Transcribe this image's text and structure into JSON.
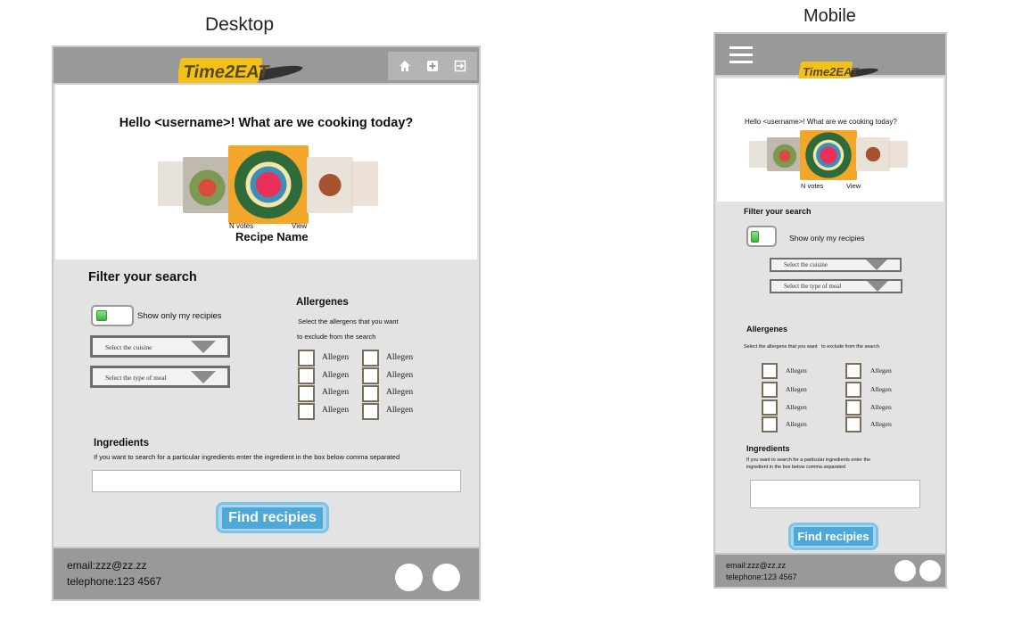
{
  "captions": {
    "desktop": "Desktop",
    "mobile": "Mobile"
  },
  "logo_text": "Time2EAT",
  "greeting": "Hello <username>! What are we cooking today?",
  "carousel": {
    "votes": "N votes",
    "view": "View",
    "recipe_name": "Recipe Name"
  },
  "filter": {
    "title": "Filter your search",
    "toggle_label": "Show only my recipies",
    "cuisine_placeholder": "Select the cuisine",
    "meal_placeholder": "Select the type of meal"
  },
  "allergenes": {
    "title": "Allergenes",
    "desc_desktop_1": "Select the allergens that you want",
    "desc_desktop_2": "to exclude from the search",
    "desc_mobile": "Select the allergens that you want   to exclude from the search",
    "items": [
      "Allegen",
      "Allegen",
      "Allegen",
      "Allegen",
      "Allegen",
      "Allegen",
      "Allegen",
      "Allegen"
    ]
  },
  "ingredients": {
    "title": "Ingredients",
    "desc": "If you want to search for a particular ingredients enter the ingredient in the box below comma separated",
    "desc_mobile_1": "If you want to search for a particular ingredients enter the",
    "desc_mobile_2": "ingredient in the box below comma separated",
    "value": ""
  },
  "find_button": "Find recipies",
  "footer": {
    "email": "email:zzz@zz.zz",
    "telephone": "telephone:123 4567"
  },
  "icons": {
    "home": "home-icon",
    "add": "plus-square-icon",
    "logout": "sign-out-icon",
    "menu": "hamburger-icon"
  },
  "colors": {
    "header": "#999999",
    "panel": "#e3e3e3",
    "button": "#4ea9d9",
    "toggle_on": "#3cb43c",
    "logo": "#f2c21b"
  }
}
